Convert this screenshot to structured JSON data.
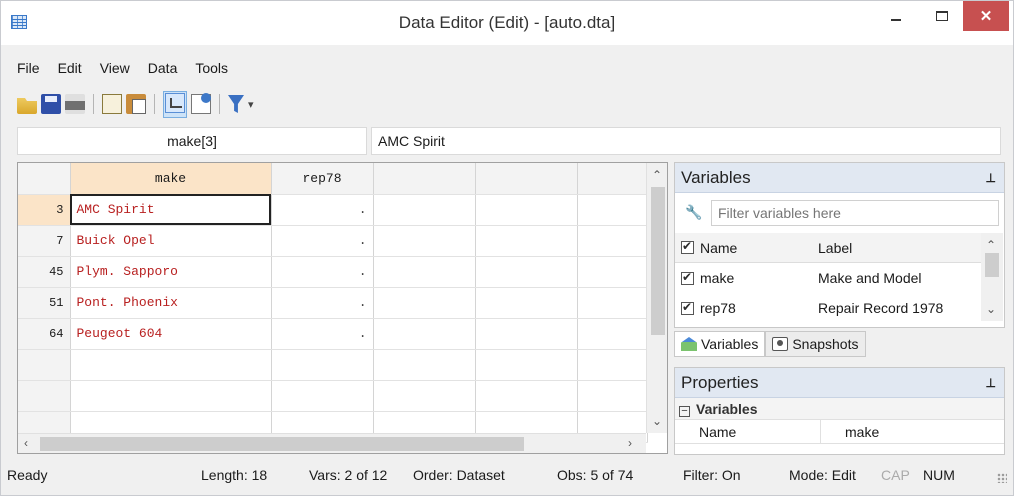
{
  "window": {
    "title": "Data Editor (Edit) - [auto.dta]",
    "close_symbol": "✕"
  },
  "menu": [
    "File",
    "Edit",
    "View",
    "Data",
    "Tools"
  ],
  "toolbar": {
    "icons": [
      "open-icon",
      "save-icon",
      "print-icon",
      "copy-icon",
      "paste-icon",
      "edit-mode-icon",
      "browse-mode-icon",
      "filter-icon"
    ]
  },
  "formula_bar": {
    "cell_ref": "make[3]",
    "cell_value": "AMC Spirit"
  },
  "grid": {
    "columns": [
      "make",
      "rep78"
    ],
    "rows": [
      {
        "num": "3",
        "make": "AMC Spirit",
        "rep78": "."
      },
      {
        "num": "7",
        "make": "Buick Opel",
        "rep78": "."
      },
      {
        "num": "45",
        "make": "Plym. Sapporo",
        "rep78": "."
      },
      {
        "num": "51",
        "make": "Pont. Phoenix",
        "rep78": "."
      },
      {
        "num": "64",
        "make": "Peugeot 604",
        "rep78": "."
      }
    ],
    "make_text_color": "#b82020",
    "selected_header_color": "#fbe4c8"
  },
  "variables_pane": {
    "title": "Variables",
    "filter_placeholder": "Filter variables here",
    "headers": {
      "name": "Name",
      "label": "Label"
    },
    "rows": [
      {
        "name": "make",
        "label": "Make and Model"
      },
      {
        "name": "rep78",
        "label": "Repair Record 1978"
      }
    ]
  },
  "pane_tabs": [
    "Variables",
    "Snapshots"
  ],
  "properties_pane": {
    "title": "Properties",
    "group": "Variables",
    "rows": [
      {
        "key": "Name",
        "value": "make"
      }
    ]
  },
  "status": {
    "state": "Ready",
    "length": "Length: 18",
    "vars": "Vars: 2 of 12",
    "order": "Order: Dataset",
    "obs": "Obs: 5 of 74",
    "filter": "Filter: On",
    "mode": "Mode: Edit",
    "cap": "CAP",
    "num": "NUM"
  }
}
